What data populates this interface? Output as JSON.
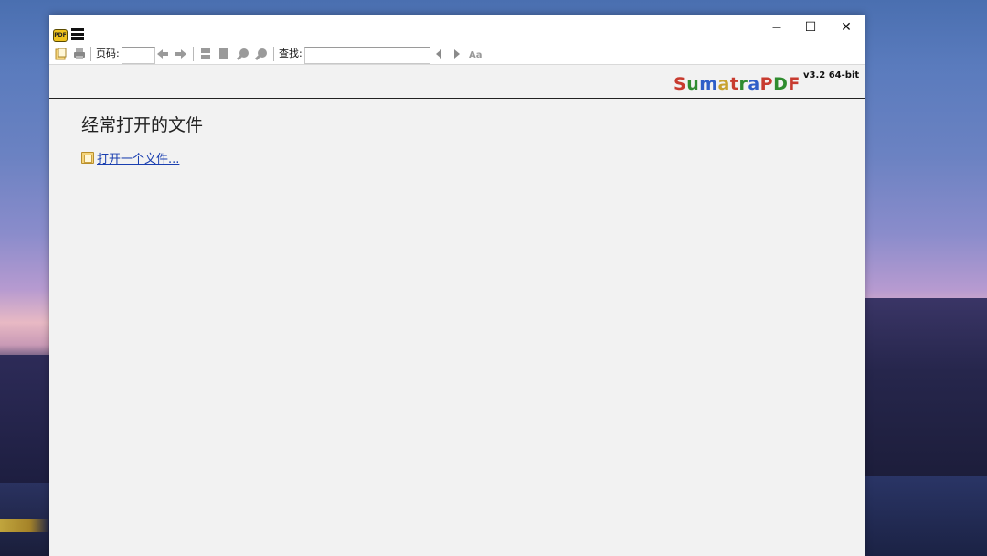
{
  "window": {
    "minimize_glyph": "—",
    "maximize_glyph": "☐",
    "close_glyph": "✕"
  },
  "toolbar": {
    "page_label": "页码:",
    "page_value": "",
    "find_label": "查找:",
    "find_value": ""
  },
  "branding": {
    "letters": [
      "S",
      "u",
      "m",
      "a",
      "t",
      "r",
      "a",
      "P",
      "D",
      "F"
    ],
    "letter_colors": [
      "#c83b2f",
      "#2f8c2f",
      "#2f5fc8",
      "#c8a22f",
      "#c83b2f",
      "#2f8c2f",
      "#2f5fc8",
      "#c83b2f",
      "#2f8c2f",
      "#c83b2f"
    ],
    "version": "v3.2 64-bit"
  },
  "home": {
    "heading": "经常打开的文件",
    "open_link": "打开一个文件..."
  },
  "colors": {
    "link": "#1a3fb0",
    "background": "#f2f2f2"
  }
}
